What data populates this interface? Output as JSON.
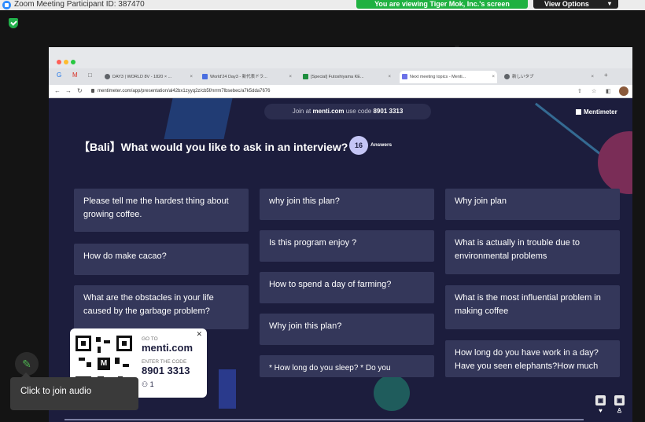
{
  "zoom": {
    "window_title": "Zoom Meeting Participant ID: 387470",
    "share_banner": "You are viewing Tiger Mok, Inc.'s screen",
    "view_options_label": "View Options",
    "audio_tooltip": "Click to join audio"
  },
  "browser": {
    "tabs": [
      {
        "label": "DAY3 | WORLD 8V - 1820 × ...",
        "favicon": "globe-icon"
      },
      {
        "label": "World'24 Day3 - 新代表ドラ...",
        "favicon": "doc-icon"
      },
      {
        "label": "[Special] Futoshiyama KE...",
        "favicon": "sheet-icon"
      },
      {
        "label": "Next meeting topics - Menti...",
        "favicon": "chart-icon"
      },
      {
        "label": "新しいタブ",
        "favicon": "globe-icon"
      }
    ],
    "url": "mentimeter.com/app/presentation/al42bx1zyyq2z/cb5f/nrrm7lbsebec/a7k5dda7676"
  },
  "slide": {
    "join_prefix": "Join at",
    "join_site": "menti.com",
    "join_use_code": "use code",
    "join_code": "8901 3313",
    "brand": "Mentimeter",
    "title": "【Bali】What would you like to ask in an interview?",
    "answers_count": "16",
    "answers_label": "Answers",
    "cards": [
      "Please tell me the hardest thing about growing coffee.",
      "How do make cacao?",
      "What are the obstacles in your life caused by the garbage problem?",
      "why join this plan?",
      "Is this program enjoy ?",
      "How to spend a day of farming?",
      "Why join this plan?",
      "* How long do you sleep? * Do you",
      "Why join plan",
      "What is actually in trouble due to environmental problems",
      "What is the most influential problem in making coffee",
      "How long do you have work in a day? Have you seen elephants?How much"
    ]
  },
  "code_card": {
    "goto_small": "GO TO",
    "goto_url": "menti.com",
    "enter_small": "ENTER THE CODE",
    "code": "8901 3313",
    "participants": "1"
  }
}
